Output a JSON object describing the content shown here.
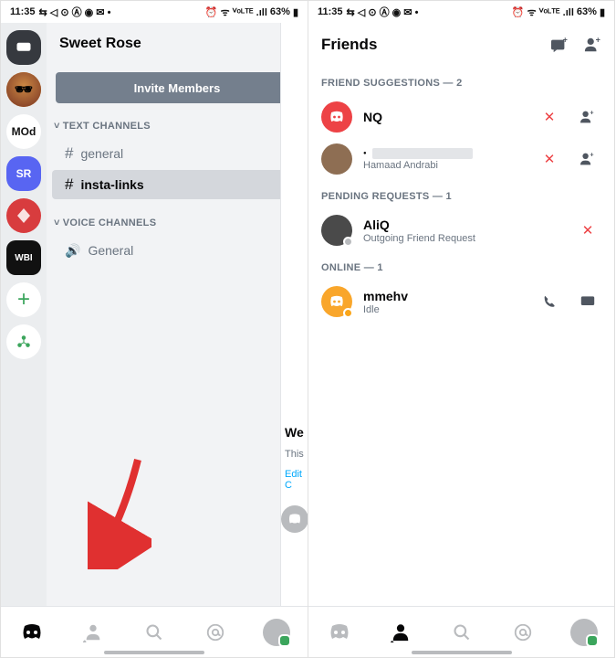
{
  "status": {
    "time": "11:35",
    "battery": "63%"
  },
  "left": {
    "server_title": "Sweet Rose",
    "invite_button": "Invite Members",
    "text_channels_header": "TEXT CHANNELS",
    "voice_channels_header": "VOICE CHANNELS",
    "channels_text": [
      {
        "name": "general",
        "selected": false
      },
      {
        "name": "insta-links",
        "selected": true
      }
    ],
    "channels_voice": [
      {
        "name": "General"
      }
    ],
    "servers": [
      {
        "id": "dm",
        "label": ""
      },
      {
        "id": "avatar1",
        "label": ""
      },
      {
        "id": "mod",
        "label": "MOd"
      },
      {
        "id": "sr",
        "label": "SR"
      },
      {
        "id": "red",
        "label": ""
      },
      {
        "id": "wbi",
        "label": "WBI"
      }
    ],
    "peek_title": "We",
    "peek_sub": "This",
    "peek_edit": "Edit C"
  },
  "right": {
    "header_title": "Friends",
    "sections": {
      "suggestions": {
        "label": "FRIEND SUGGESTIONS — 2"
      },
      "pending": {
        "label": "PENDING REQUESTS — 1"
      },
      "online": {
        "label": "ONLINE — 1"
      }
    },
    "suggestions": [
      {
        "name": "NQ",
        "sub": "",
        "avatar": "red",
        "blurred": false
      },
      {
        "name": "",
        "sub": "Hamaad Andrabi",
        "avatar": "img1",
        "blurred": true
      }
    ],
    "pending": [
      {
        "name": "AliQ",
        "sub": "Outgoing Friend Request",
        "avatar": "img2"
      }
    ],
    "online": [
      {
        "name": "mmehv",
        "sub": "Idle",
        "avatar": "orange"
      }
    ]
  }
}
